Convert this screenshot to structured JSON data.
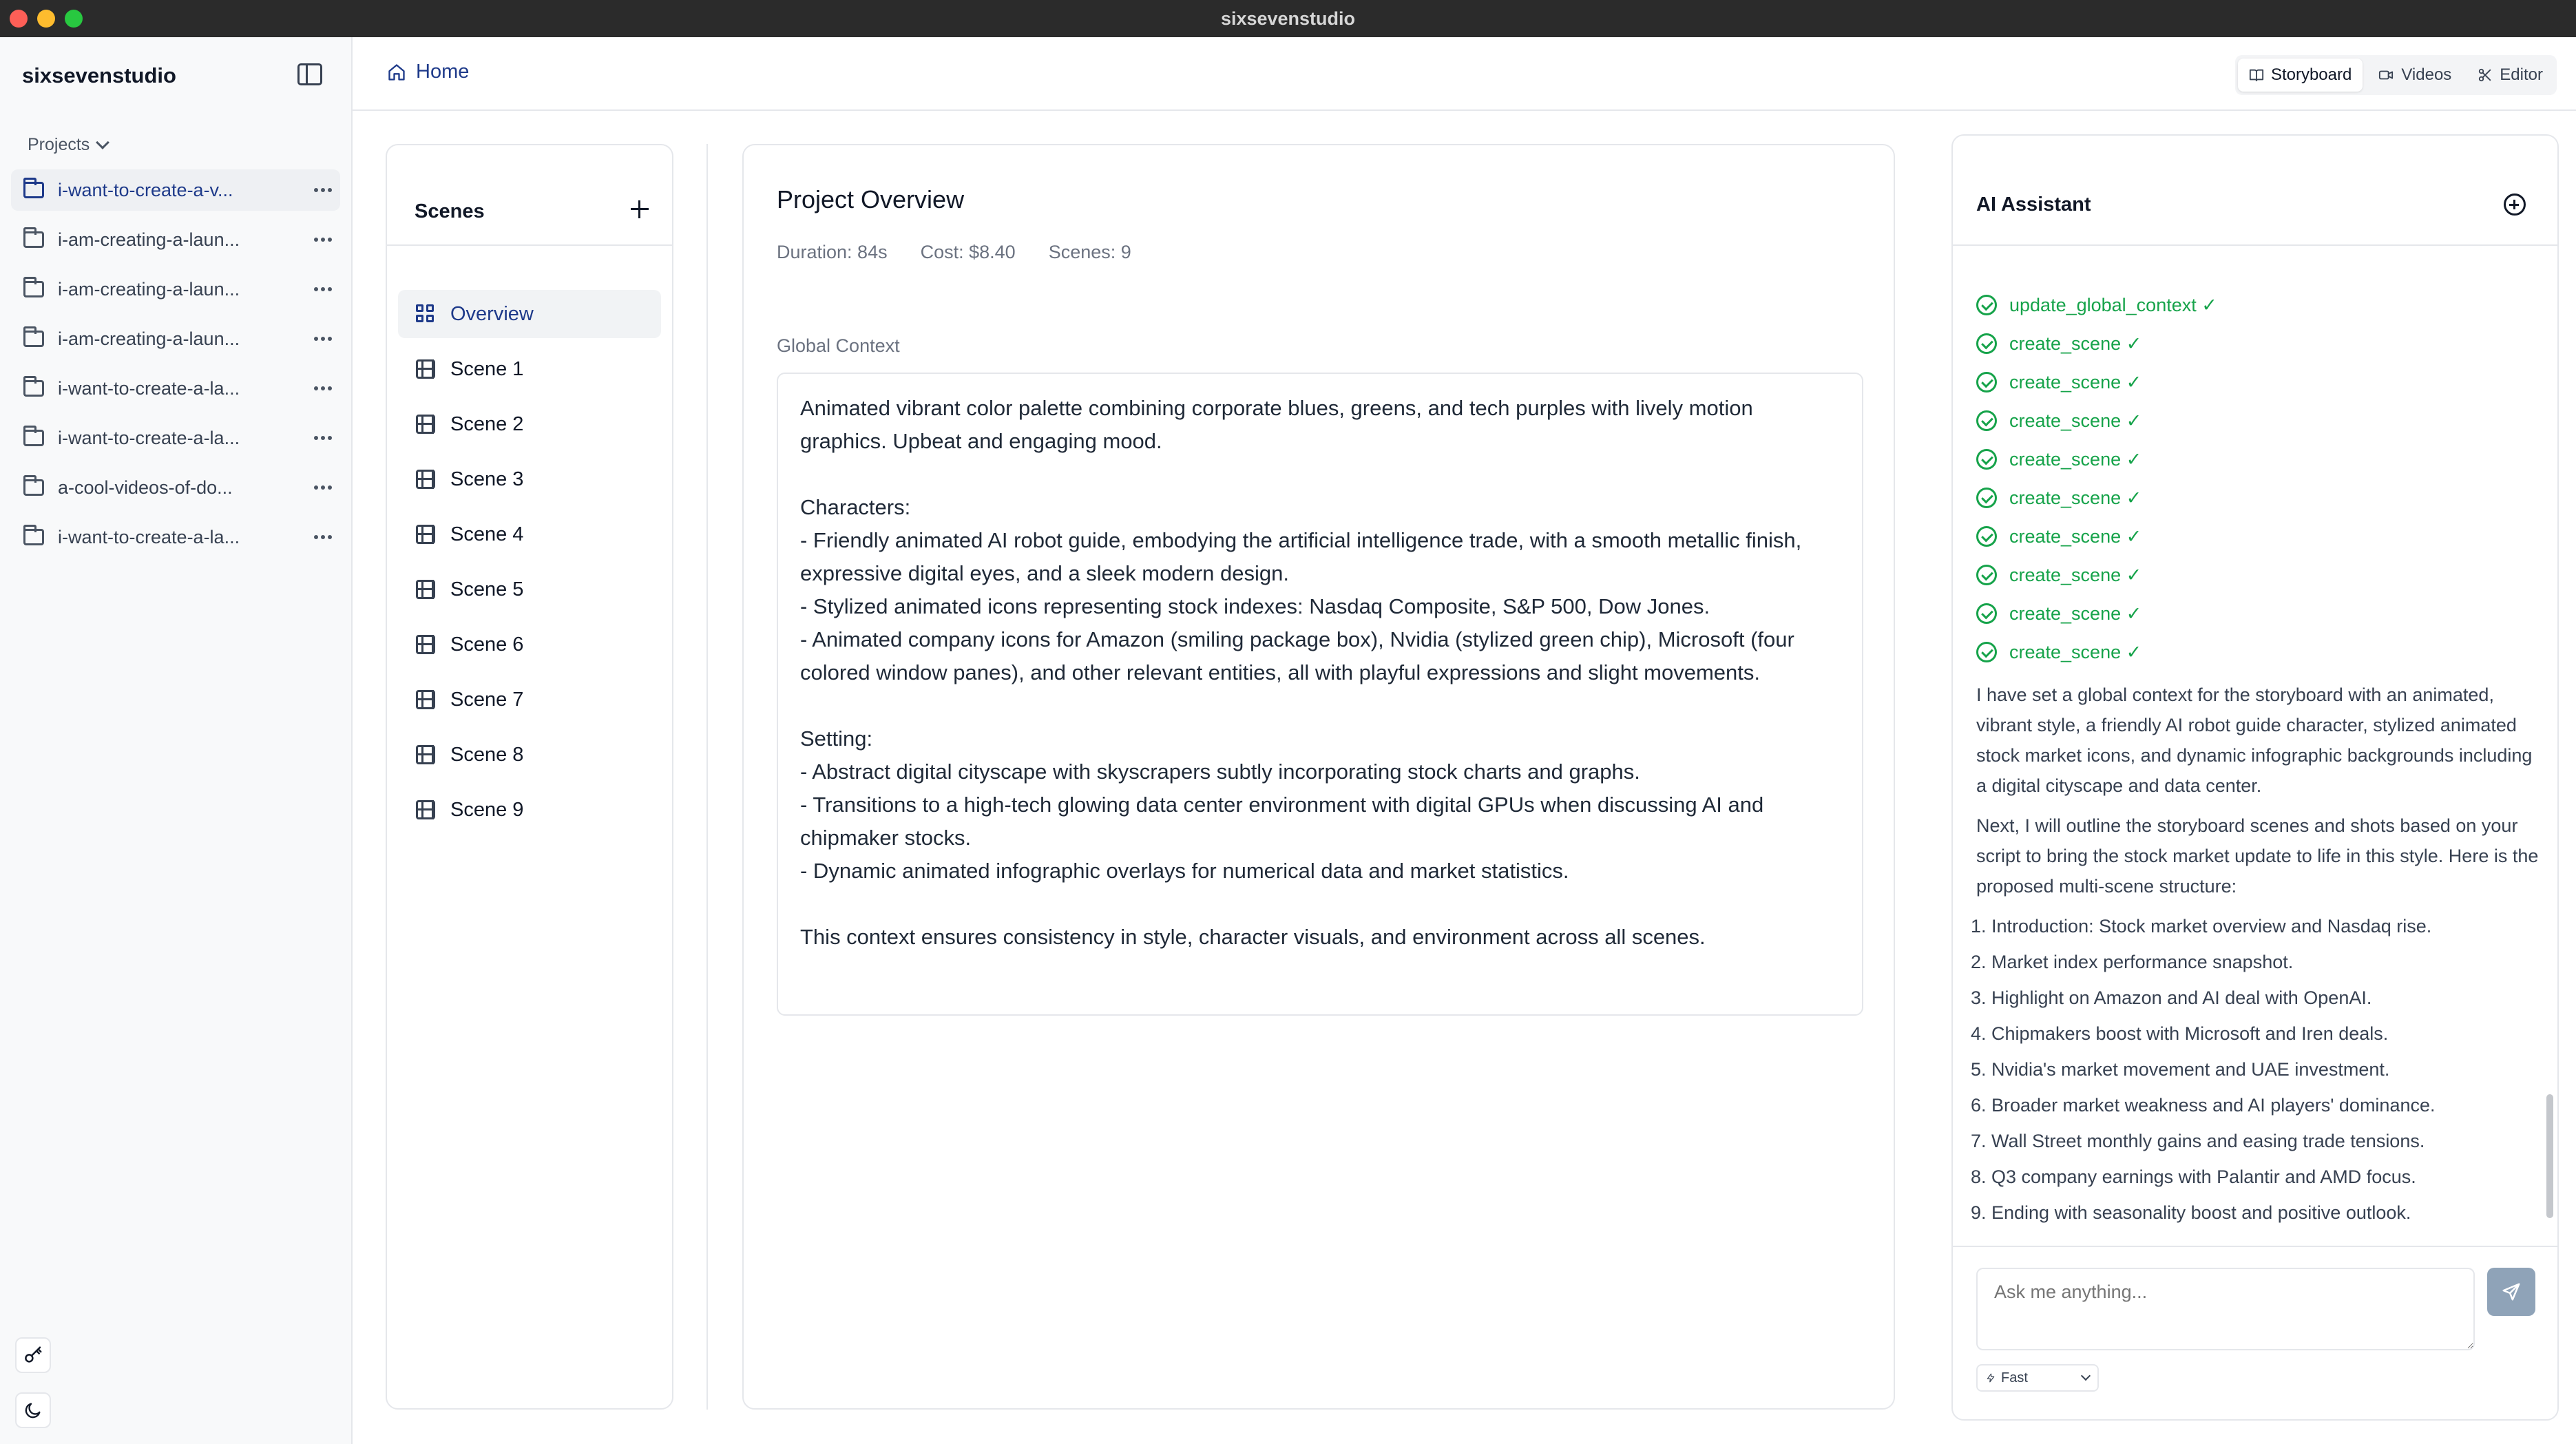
{
  "window": {
    "title": "sixsevenstudio"
  },
  "sidebar": {
    "brand": "sixsevenstudio",
    "projects_label": "Projects",
    "projects": [
      {
        "name": "i-want-to-create-a-v...",
        "active": true
      },
      {
        "name": "i-am-creating-a-laun...",
        "active": false
      },
      {
        "name": "i-am-creating-a-laun...",
        "active": false
      },
      {
        "name": "i-am-creating-a-laun...",
        "active": false
      },
      {
        "name": "i-want-to-create-a-la...",
        "active": false
      },
      {
        "name": "i-want-to-create-a-la...",
        "active": false
      },
      {
        "name": "a-cool-videos-of-do...",
        "active": false
      },
      {
        "name": "i-want-to-create-a-la...",
        "active": false
      }
    ]
  },
  "header": {
    "breadcrumb": "Home",
    "views": [
      {
        "label": "Storyboard",
        "icon": "book-open-icon",
        "active": true
      },
      {
        "label": "Videos",
        "icon": "video-icon",
        "active": false
      },
      {
        "label": "Editor",
        "icon": "scissors-icon",
        "active": false
      }
    ]
  },
  "scenes": {
    "title": "Scenes",
    "items": [
      {
        "label": "Overview",
        "icon": "grid-icon",
        "active": true
      },
      {
        "label": "Scene 1",
        "icon": "film-icon"
      },
      {
        "label": "Scene 2",
        "icon": "film-icon"
      },
      {
        "label": "Scene 3",
        "icon": "film-icon"
      },
      {
        "label": "Scene 4",
        "icon": "film-icon"
      },
      {
        "label": "Scene 5",
        "icon": "film-icon"
      },
      {
        "label": "Scene 6",
        "icon": "film-icon"
      },
      {
        "label": "Scene 7",
        "icon": "film-icon"
      },
      {
        "label": "Scene 8",
        "icon": "film-icon"
      },
      {
        "label": "Scene 9",
        "icon": "film-icon"
      }
    ]
  },
  "overview": {
    "title": "Project Overview",
    "duration": "Duration: 84s",
    "cost": "Cost: $8.40",
    "scenes_count": "Scenes: 9",
    "global_context_label": "Global Context",
    "global_context": "Animated vibrant color palette combining corporate blues, greens, and tech purples with lively motion graphics. Upbeat and engaging mood.\n\nCharacters:\n- Friendly animated AI robot guide, embodying the artificial intelligence trade, with a smooth metallic finish, expressive digital eyes, and a sleek modern design.\n- Stylized animated icons representing stock indexes: Nasdaq Composite, S&P 500, Dow Jones.\n- Animated company icons for Amazon (smiling package box), Nvidia (stylized green chip), Microsoft (four colored window panes), and other relevant entities, all with playful expressions and slight movements.\n\nSetting:\n- Abstract digital cityscape with skyscrapers subtly incorporating stock charts and graphs.\n- Transitions to a high-tech glowing data center environment with digital GPUs when discussing AI and chipmaker stocks.\n- Dynamic animated infographic overlays for numerical data and market statistics.\n\nThis context ensures consistency in style, character visuals, and environment across all scenes."
  },
  "assistant": {
    "title": "AI Assistant",
    "tool_calls": [
      "update_global_context ✓",
      "create_scene ✓",
      "create_scene ✓",
      "create_scene ✓",
      "create_scene ✓",
      "create_scene ✓",
      "create_scene ✓",
      "create_scene ✓",
      "create_scene ✓",
      "create_scene ✓"
    ],
    "message_1": "I have set a global context for the storyboard with an animated, vibrant style, a friendly AI robot guide character, stylized animated stock market icons, and dynamic infographic backgrounds including a digital cityscape and data center.",
    "message_2": "Next, I will outline the storyboard scenes and shots based on your script to bring the stock market update to life in this style. Here is the proposed multi-scene structure:",
    "plan": [
      {
        "num": "1.",
        "text": "Introduction: Stock market overview and Nasdaq rise."
      },
      {
        "num": "2.",
        "text": "Market index performance snapshot."
      },
      {
        "num": "3.",
        "text": "Highlight on Amazon and AI deal with OpenAI."
      },
      {
        "num": "4.",
        "text": "Chipmakers boost with Microsoft and Iren deals."
      },
      {
        "num": "5.",
        "text": "Nvidia's market movement and UAE investment."
      },
      {
        "num": "6.",
        "text": "Broader market weakness and AI players' dominance."
      },
      {
        "num": "7.",
        "text": "Wall Street monthly gains and easing trade tensions."
      },
      {
        "num": "8.",
        "text": "Q3 company earnings with Palantir and AMD focus."
      },
      {
        "num": "9.",
        "text": "Ending with seasonality boost and positive outlook."
      }
    ],
    "input_placeholder": "Ask me anything...",
    "mode": "Fast"
  },
  "colors": {
    "accent": "#1e3a8a",
    "success": "#16a34a",
    "send_button": "#8fa3b8"
  }
}
